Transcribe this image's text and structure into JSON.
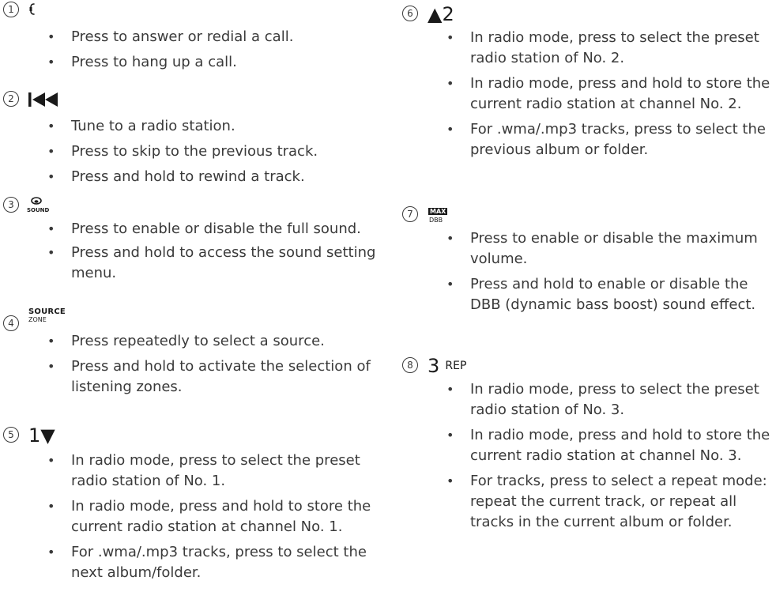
{
  "left_column": [
    {
      "number": "1",
      "symbol_icon": "phone-handset-icon",
      "bullets": [
        "Press to answer or redial a call.",
        "Press to hang up a call."
      ]
    },
    {
      "number": "2",
      "symbol_icon": "previous-track-icon",
      "bullets": [
        "Tune to a radio station.",
        "Press to skip to the previous track.",
        "Press and hold to rewind a track."
      ]
    },
    {
      "number": "3",
      "symbol_icon": "sound-icon",
      "symbol_caption": "SOUND",
      "bullets": [
        "Press to enable or disable the full sound.",
        "Press and hold to access the sound setting menu."
      ]
    },
    {
      "number": "4",
      "symbol_label": "SOURCE",
      "symbol_sub": "ZONE",
      "bullets": [
        "Press repeatedly to select a source.",
        "Press and hold to activate the selection of listening zones."
      ]
    },
    {
      "number": "5",
      "symbol_text": "1▼",
      "bullets": [
        "In radio mode, press to select the preset radio station of No. 1.",
        "In radio mode, press and hold to store the current radio station at channel No. 1.",
        "For .wma/.mp3 tracks, press to select the next album/folder."
      ]
    }
  ],
  "right_column": [
    {
      "number": "6",
      "symbol_text": "▲2",
      "bullets": [
        "In radio mode, press to select the preset radio station of No. 2.",
        "In radio mode, press and hold to store the current radio station at channel No. 2.",
        "For .wma/.mp3 tracks, press to select the previous album or folder."
      ]
    },
    {
      "number": "7",
      "symbol_label": "MAX",
      "symbol_sub": "DBB",
      "bullets": [
        "Press to enable or disable the maximum volume.",
        "Press and hold to enable or disable the DBB (dynamic bass boost) sound effect."
      ]
    },
    {
      "number": "8",
      "symbol_text": "3",
      "symbol_suffix": "REP",
      "bullets": [
        "In radio mode, press to select the preset radio station of No. 3.",
        "In radio mode, press and hold to store the current radio station at channel No. 3.",
        "For tracks, press to select a repeat mode: repeat the current track, or repeat all tracks in the current album or folder."
      ]
    }
  ]
}
